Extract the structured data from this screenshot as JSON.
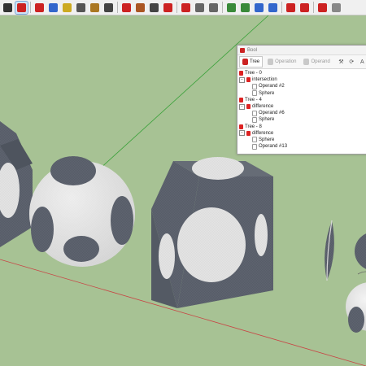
{
  "toolbar": {
    "buttons": [
      {
        "icon": "select-arrow-icon",
        "color": "#333333"
      },
      {
        "icon": "move-icon",
        "color": "#cc2222",
        "active": true
      },
      {
        "icon": "rotate-icon",
        "color": "#cc2222"
      },
      {
        "icon": "scale-icon",
        "color": "#3366cc"
      },
      {
        "icon": "tape-measure-icon",
        "color": "#ccaa22"
      },
      {
        "icon": "dimension-icon",
        "color": "#555555"
      },
      {
        "icon": "protractor-icon",
        "color": "#aa7722"
      },
      {
        "icon": "text-icon",
        "color": "#444444"
      },
      {
        "icon": "orbit-icon",
        "color": "#cc2222"
      },
      {
        "icon": "pan-icon",
        "color": "#aa5522"
      },
      {
        "icon": "zoom-icon",
        "color": "#444444"
      },
      {
        "icon": "zoom-extents-icon",
        "color": "#cc2222"
      },
      {
        "icon": "shaded-style-icon",
        "color": "#cc2222"
      },
      {
        "icon": "texture-style-icon",
        "color": "#666666"
      },
      {
        "icon": "xray-style-icon",
        "color": "#666666"
      },
      {
        "icon": "scenes-icon",
        "color": "#3a8a3a"
      },
      {
        "icon": "layers-icon",
        "color": "#3a8a3a"
      },
      {
        "icon": "components-icon",
        "color": "#3366cc"
      },
      {
        "icon": "materials-icon",
        "color": "#3366cc"
      },
      {
        "icon": "export-rb-icon",
        "color": "#cc2222"
      },
      {
        "icon": "export-rbz-icon",
        "color": "#cc2222"
      },
      {
        "icon": "boolean-icon",
        "color": "#cc2222"
      },
      {
        "icon": "solid-icon",
        "color": "#888888"
      }
    ]
  },
  "bool_panel": {
    "title": "Bool",
    "tabs": [
      {
        "label": "Tree",
        "selected": true
      },
      {
        "label": "Operation",
        "selected": false
      },
      {
        "label": "Operand",
        "selected": false
      }
    ],
    "tools": [
      {
        "icon": "wrench-icon",
        "text": "⚒"
      },
      {
        "icon": "refresh-icon",
        "text": "⟳"
      },
      {
        "icon": "text-style-icon",
        "text": "A"
      }
    ],
    "tree": [
      {
        "level": 0,
        "label": "Tree - 0",
        "icon": "red",
        "expander": ""
      },
      {
        "level": 0,
        "label": "intersection",
        "icon": "red",
        "expander": "−"
      },
      {
        "level": 1,
        "label": "Operand #2",
        "icon": "leaf",
        "expander": ""
      },
      {
        "level": 1,
        "label": "Sphere",
        "icon": "leaf",
        "expander": ""
      },
      {
        "level": 0,
        "label": "Tree - 4",
        "icon": "red",
        "expander": ""
      },
      {
        "level": 0,
        "label": "difference",
        "icon": "red",
        "expander": "−"
      },
      {
        "level": 1,
        "label": "Operand #6",
        "icon": "leaf",
        "expander": ""
      },
      {
        "level": 1,
        "label": "Sphere",
        "icon": "leaf",
        "expander": ""
      },
      {
        "level": 0,
        "label": "Tree - 8",
        "icon": "red",
        "expander": ""
      },
      {
        "level": 0,
        "label": "difference",
        "icon": "red",
        "expander": "−"
      },
      {
        "level": 1,
        "label": "Sphere",
        "icon": "leaf",
        "expander": ""
      },
      {
        "level": 1,
        "label": "Operand #13",
        "icon": "leaf",
        "expander": ""
      }
    ]
  },
  "colors": {
    "ground": "#a7c294",
    "solid_dark": "#5a606b",
    "solid_light": "#e2e2e2"
  }
}
